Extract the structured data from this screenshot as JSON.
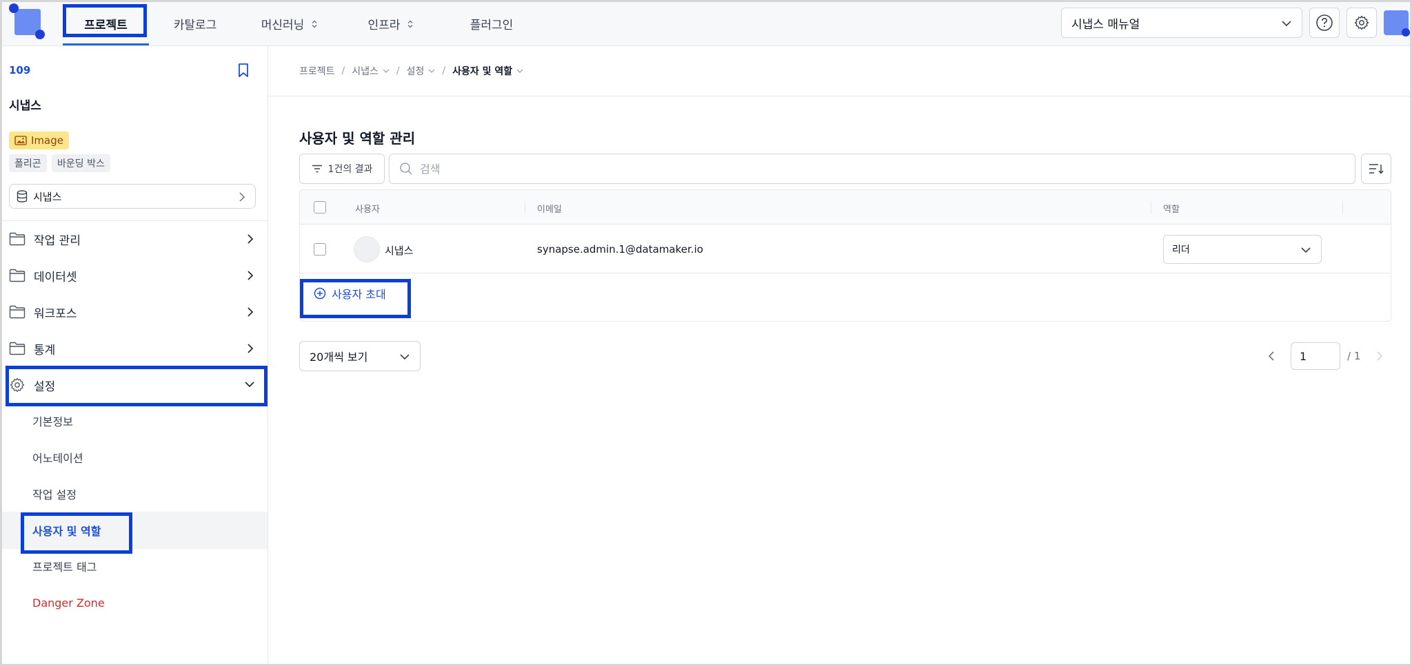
{
  "topnav": {
    "items": [
      {
        "label": "프로젝트",
        "active": true,
        "dropdown": false
      },
      {
        "label": "카탈로그",
        "active": false,
        "dropdown": false
      },
      {
        "label": "머신러닝",
        "active": false,
        "dropdown": true
      },
      {
        "label": "인프라",
        "active": false,
        "dropdown": true
      },
      {
        "label": "플러그인",
        "active": false,
        "dropdown": false
      }
    ],
    "manual_select": "시냅스 매뉴얼",
    "help_icon": "question-circle-icon",
    "settings_icon": "gear-icon"
  },
  "sidebar": {
    "project_id": "109",
    "project_name": "시냅스",
    "data_type_tag": "Image",
    "annotation_tags": [
      "폴리곤",
      "바운딩 박스"
    ],
    "dataset_selector": "시냅스",
    "menu": [
      {
        "label": "작업 관리",
        "icon": "folder-icon"
      },
      {
        "label": "데이터셋",
        "icon": "folder-icon"
      },
      {
        "label": "워크포스",
        "icon": "folder-icon"
      },
      {
        "label": "통계",
        "icon": "folder-icon"
      },
      {
        "label": "설정",
        "icon": "gear-icon",
        "expanded": true
      }
    ],
    "settings_sub": [
      {
        "label": "기본정보"
      },
      {
        "label": "어노테이션"
      },
      {
        "label": "작업 설정"
      },
      {
        "label": "사용자 및 역할",
        "active": true
      },
      {
        "label": "프로젝트 태그"
      },
      {
        "label": "Danger Zone",
        "danger": true
      }
    ]
  },
  "main": {
    "breadcrumb": [
      "프로젝트",
      "시냅스",
      "설정",
      "사용자 및 역할"
    ],
    "title": "사용자 및 역할 관리",
    "result_count": "1건의 결과",
    "search_placeholder": "검색",
    "table": {
      "headers": [
        "사용자",
        "이메일",
        "역할"
      ],
      "rows": [
        {
          "name": "시냅스",
          "email": "synapse.admin.1@datamaker.io",
          "role": "리더"
        }
      ]
    },
    "invite_label": "사용자 초대",
    "page_size": "20개씩 보기",
    "pagination": {
      "current": "1",
      "total": "/ 1"
    }
  },
  "colors": {
    "accent": "#1d4ed8",
    "highlight_box": "#0b3fd8",
    "danger": "#dc2626",
    "image_tag_bg": "#fde68a"
  }
}
